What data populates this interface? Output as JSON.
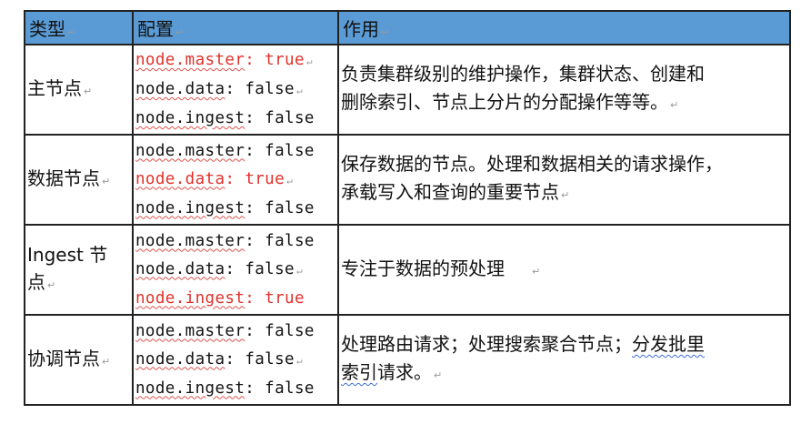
{
  "table": {
    "headers": [
      "类型",
      "配置",
      "作用"
    ],
    "rows": [
      {
        "type": "主节点",
        "configs": [
          {
            "key": "node.master",
            "sep": ": ",
            "value": "true",
            "highlight": true
          },
          {
            "key": "node.data",
            "sep": ": ",
            "value": "false",
            "highlight": false
          },
          {
            "key": "node.ingest",
            "sep": ": ",
            "value": "false",
            "highlight": false
          }
        ],
        "desc_lines": [
          "负责集群级别的维护操作，集群状态、创建和",
          "删除索引、节点上分片的分配操作等等。"
        ]
      },
      {
        "type": "数据节点",
        "configs": [
          {
            "key": "node.master",
            "sep": ": ",
            "value": "false",
            "highlight": false
          },
          {
            "key": "node.data",
            "sep": ": ",
            "value": "true",
            "highlight": true
          },
          {
            "key": "node.ingest",
            "sep": ": ",
            "value": "false",
            "highlight": false
          }
        ],
        "desc_lines": [
          "保存数据的节点。处理和数据相关的请求操作，",
          "承载写入和查询的重要节点"
        ]
      },
      {
        "type_lines": [
          "Ingest 节",
          "点"
        ],
        "configs": [
          {
            "key": "node.master",
            "sep": ": ",
            "value": "false",
            "highlight": false
          },
          {
            "key": "node.data",
            "sep": ": ",
            "value": "false",
            "highlight": false
          },
          {
            "key": "node.ingest",
            "sep": ": ",
            "value": "true",
            "highlight": true
          }
        ],
        "desc_lines": [
          "专注于数据的预处理"
        ]
      },
      {
        "type": "协调节点",
        "configs": [
          {
            "key": "node.master",
            "sep": ": ",
            "value": "false",
            "highlight": false
          },
          {
            "key": "node.data",
            "sep": ": ",
            "value": "false",
            "highlight": false
          },
          {
            "key": "node.ingest",
            "sep": ": ",
            "value": "false",
            "highlight": false
          }
        ],
        "desc_a": "处理路由请求；处理搜索聚合节点；",
        "desc_b": "分发批里",
        "desc_c": "索引",
        "desc_d": "请求。"
      }
    ]
  },
  "colors": {
    "header_bg": "#5b9bd5",
    "highlight": "#e0322b"
  },
  "mark": "↵"
}
